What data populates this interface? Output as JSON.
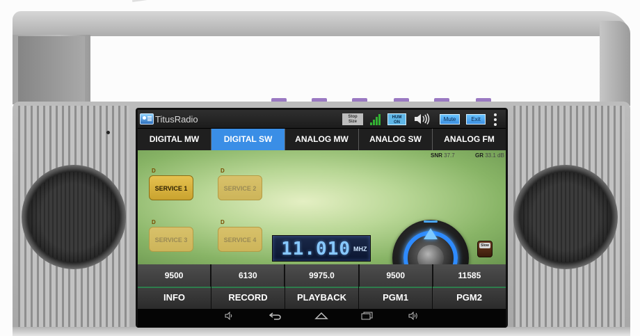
{
  "app": {
    "title": "TitusRadio",
    "stop_size_label": "Stop\nSize",
    "hum_label": "HUM\nON",
    "mute_label": "Mute",
    "exit_label": "Exit"
  },
  "tabs": [
    {
      "label": "DIGITAL MW",
      "active": false
    },
    {
      "label": "DIGITAL SW",
      "active": true
    },
    {
      "label": "ANALOG MW",
      "active": false
    },
    {
      "label": "ANALOG SW",
      "active": false
    },
    {
      "label": "ANALOG FM",
      "active": false
    }
  ],
  "signal": {
    "snr_label": "SNR",
    "snr_value": "37.7",
    "gr_label": "GR",
    "gr_value": "33.1 dB"
  },
  "services": [
    {
      "tag": "D",
      "label": "SERVICE 1",
      "active": true
    },
    {
      "tag": "D",
      "label": "SERVICE 2",
      "active": false
    },
    {
      "tag": "D",
      "label": "SERVICE 3",
      "active": false
    },
    {
      "tag": "D",
      "label": "SERVICE 4",
      "active": false
    }
  ],
  "frequency": {
    "value": "11.010",
    "unit": "MHZ"
  },
  "slow_label": "Slow",
  "presets": [
    "9500",
    "6130",
    "9975.0",
    "9500",
    "11585"
  ],
  "functions": [
    "INFO",
    "RECORD",
    "PLAYBACK",
    "PGM1",
    "PGM2"
  ],
  "icons": {
    "status": [
      "app-icon",
      "signal-icon",
      "volume-icon",
      "overflow-menu-icon"
    ],
    "nav": [
      "volume-down-icon",
      "back-icon",
      "home-icon",
      "recent-apps-icon",
      "volume-up-icon"
    ]
  },
  "colors": {
    "active_tab": "#3a8ee6",
    "service_active": "#e6c14f",
    "display_text": "#87c8ff",
    "knob_ring": "#2e8bff"
  }
}
